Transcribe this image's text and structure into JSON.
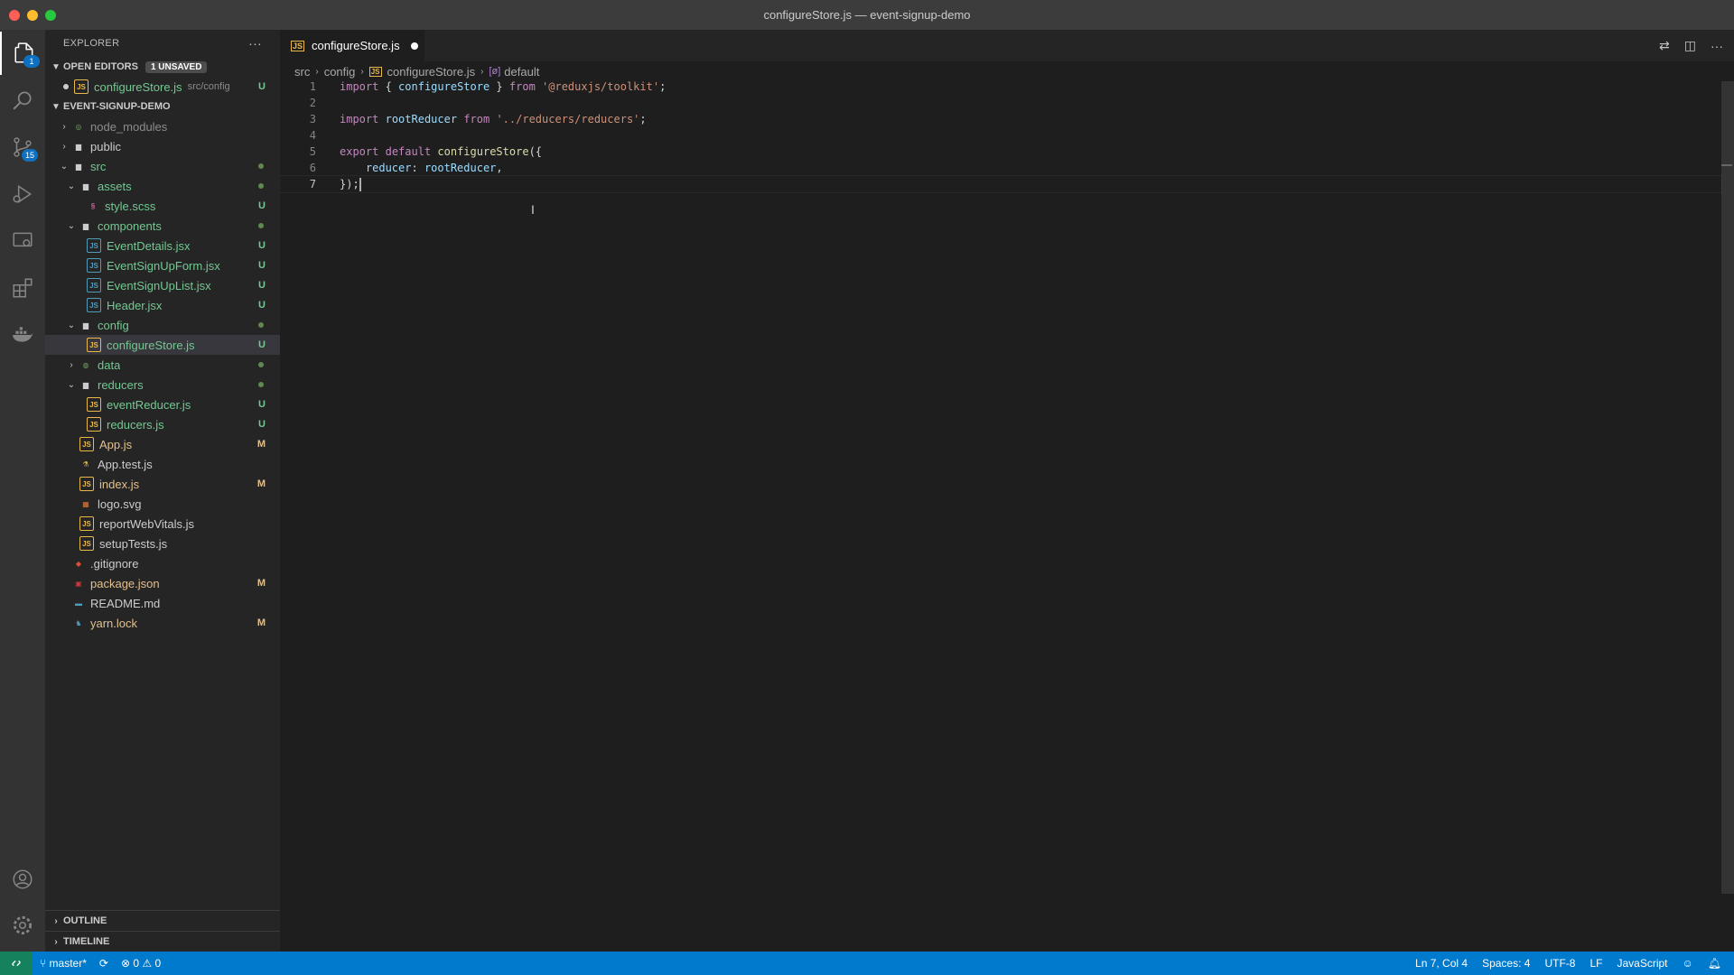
{
  "window": {
    "title": "configureStore.js — event-signup-demo"
  },
  "activity_bar": {
    "items": [
      {
        "name": "explorer-icon",
        "badge": "1"
      },
      {
        "name": "search-icon"
      },
      {
        "name": "source-control-icon",
        "badge": "15"
      },
      {
        "name": "run-debug-icon"
      },
      {
        "name": "remote-explorer-icon"
      },
      {
        "name": "extensions-icon"
      },
      {
        "name": "docker-icon"
      }
    ],
    "bottom": [
      {
        "name": "accounts-icon"
      },
      {
        "name": "settings-gear-icon"
      }
    ]
  },
  "sidebar": {
    "header": "EXPLORER",
    "open_editors": {
      "title": "OPEN EDITORS",
      "badge": "1 UNSAVED",
      "items": [
        {
          "name": "configureStore.js",
          "path": "src/config",
          "status": "U"
        }
      ]
    },
    "project": {
      "title": "EVENT-SIGNUP-DEMO"
    },
    "tree": [
      {
        "label": "node_modules",
        "status": ""
      },
      {
        "label": "public",
        "status": ""
      },
      {
        "label": "src",
        "status": ""
      },
      {
        "label": "assets",
        "status": ""
      },
      {
        "label": "style.scss",
        "status": "U"
      },
      {
        "label": "components",
        "status": ""
      },
      {
        "label": "EventDetails.jsx",
        "status": "U"
      },
      {
        "label": "EventSignUpForm.jsx",
        "status": "U"
      },
      {
        "label": "EventSignUpList.jsx",
        "status": "U"
      },
      {
        "label": "Header.jsx",
        "status": "U"
      },
      {
        "label": "config",
        "status": ""
      },
      {
        "label": "configureStore.js",
        "status": "U"
      },
      {
        "label": "data",
        "status": ""
      },
      {
        "label": "reducers",
        "status": ""
      },
      {
        "label": "eventReducer.js",
        "status": "U"
      },
      {
        "label": "reducers.js",
        "status": "U"
      },
      {
        "label": "App.js",
        "status": "M"
      },
      {
        "label": "App.test.js",
        "status": ""
      },
      {
        "label": "index.js",
        "status": "M"
      },
      {
        "label": "logo.svg",
        "status": ""
      },
      {
        "label": "reportWebVitals.js",
        "status": ""
      },
      {
        "label": "setupTests.js",
        "status": ""
      },
      {
        "label": ".gitignore",
        "status": ""
      },
      {
        "label": "package.json",
        "status": "M"
      },
      {
        "label": "README.md",
        "status": ""
      },
      {
        "label": "yarn.lock",
        "status": "M"
      }
    ],
    "outline": "OUTLINE",
    "timeline": "TIMELINE"
  },
  "editor": {
    "tab": {
      "label": "configureStore.js",
      "file_icon": "JS"
    },
    "breadcrumb": {
      "p1": "src",
      "p2": "config",
      "p3": "configureStore.js",
      "p4": "default",
      "file_icon": "JS",
      "symbol_icon": "[ø]"
    },
    "lines": [
      {
        "n": "1",
        "t": "import { configureStore } from '@reduxjs/toolkit';"
      },
      {
        "n": "2",
        "t": ""
      },
      {
        "n": "3",
        "t": "import rootReducer from '../reducers/reducers';"
      },
      {
        "n": "4",
        "t": ""
      },
      {
        "n": "5",
        "t": "export default configureStore({"
      },
      {
        "n": "6",
        "t": "    reducer: rootReducer,"
      },
      {
        "n": "7",
        "t": "});"
      }
    ]
  },
  "status_bar": {
    "branch": "master*",
    "errors": "0",
    "warnings": "0",
    "position": "Ln 7, Col 4",
    "spaces": "Spaces: 4",
    "encoding": "UTF-8",
    "eol": "LF",
    "language": "JavaScript"
  }
}
